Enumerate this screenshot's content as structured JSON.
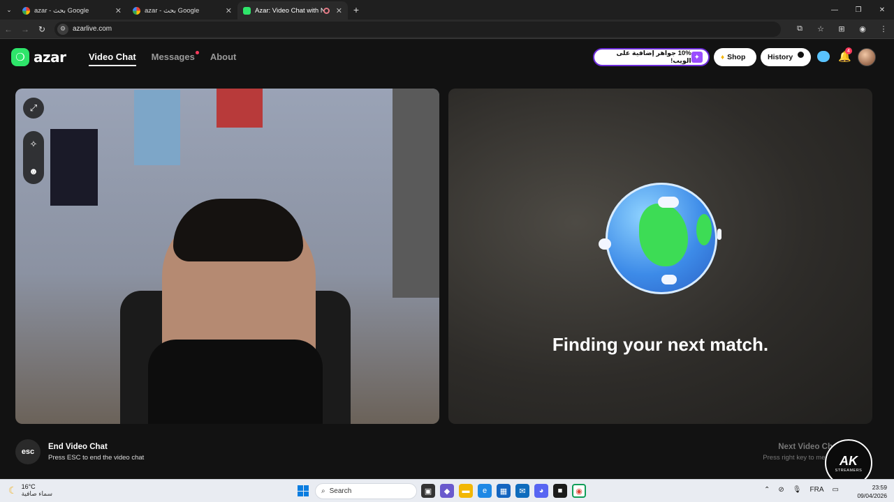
{
  "browser": {
    "tabs": [
      {
        "title": "azar - بحث Google",
        "active": false
      },
      {
        "title": "azar - بحث Google",
        "active": false
      },
      {
        "title": "Azar: Video Chat with New",
        "active": true
      }
    ],
    "url": "azarlive.com"
  },
  "site": {
    "logo": "azar",
    "nav": [
      {
        "label": "Video Chat",
        "active": true
      },
      {
        "label": "Messages",
        "active": false,
        "has_dot": true
      },
      {
        "label": "About",
        "active": false
      }
    ],
    "promo_text": "10% جواهر إضافية على الويب!",
    "shop_label": "Shop",
    "history_label": "History",
    "notification_count": "4"
  },
  "match": {
    "status_text": "Finding your next match."
  },
  "controls": {
    "esc_key": "esc",
    "end_title": "End Video Chat",
    "end_sub": "Press ESC to end the video chat",
    "next_title": "Next Video Ch",
    "next_sub": "Press right key to meet ot"
  },
  "watermark": {
    "title": "AK",
    "subtitle": "STREAMERS"
  },
  "taskbar": {
    "weather_temp": "16°C",
    "weather_desc": "سماء صافية",
    "search_placeholder": "Search",
    "lang": "FRA",
    "time": "23:59",
    "date": "09/04/2026"
  },
  "colors": {
    "brand_green": "#2ee56a",
    "promo_border": "#6c2bd9",
    "badge_red": "#ff3b5c"
  }
}
